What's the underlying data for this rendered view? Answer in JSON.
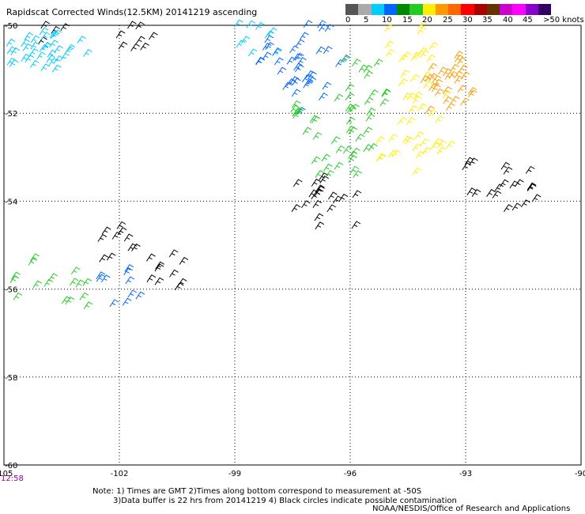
{
  "title": "Rapidscat Corrected Winds(12.5KM) 20141219 ascending",
  "legend": {
    "labels": [
      "0",
      "5",
      "10",
      "15",
      "20",
      "25",
      "30",
      "35",
      "40",
      "45",
      ">50 knots"
    ],
    "colors": [
      "#555555",
      "#aaaaaa",
      "#00ccff",
      "#0066ff",
      "#008800",
      "#22cc22",
      "#ffee00",
      "#ff9900",
      "#ff6600",
      "#ff0000",
      "#aa0000",
      "#663300",
      "#cc00cc",
      "#ff00ff",
      "#8800cc",
      "#330066"
    ]
  },
  "axes": {
    "x_ticks": [
      "-105",
      "-102",
      "-99",
      "-96",
      "-93",
      "-90"
    ],
    "y_ticks": [
      "-50",
      "-52",
      "-54",
      "-56",
      "-58",
      "-60"
    ],
    "xlim": [
      -105,
      -90
    ],
    "ylim": [
      -60,
      -50
    ],
    "grid": true
  },
  "time_label": "12:58",
  "notes": [
    "Note: 1) Times are GMT 2)Times along bottom correspond to measurement at -50S",
    "3)Data buffer is 22 hrs from 20141219 4) Black circles indicate possible contamination"
  ],
  "credit": "NOAA/NESDIS/Office of Research and Applications",
  "chart_data": {
    "type": "scatter",
    "title": "Rapidscat Corrected Winds(12.5KM) 20141219 ascending",
    "xlabel": "",
    "ylabel": "",
    "xlim": [
      -105,
      -90
    ],
    "ylim": [
      -60,
      -50
    ],
    "grid": true,
    "series": [
      {
        "name": "0-5 knots",
        "color": "#000000",
        "points": [
          [
            -97.0,
            -53.9
          ],
          [
            -96.5,
            -54.2
          ],
          [
            -102.0,
            -55.0
          ],
          [
            -101.0,
            -55.6
          ],
          [
            -91.5,
            -53.8
          ],
          [
            -92.5,
            -53.6
          ],
          [
            -103.5,
            -50.2
          ],
          [
            -101.5,
            -50.2
          ]
        ]
      },
      {
        "name": "5-10 knots",
        "color": "#00ccff",
        "points": [
          [
            -104.5,
            -50.4
          ],
          [
            -104.0,
            -50.6
          ],
          [
            -103.5,
            -50.7
          ],
          [
            -104.8,
            -50.9
          ],
          [
            -98.5,
            -50.3
          ]
        ]
      },
      {
        "name": "10-15 knots",
        "color": "#0066ff",
        "points": [
          [
            -98.0,
            -50.7
          ],
          [
            -97.5,
            -51.0
          ],
          [
            -97.2,
            -51.6
          ],
          [
            -96.8,
            -50.5
          ],
          [
            -102.0,
            -56.0
          ]
        ]
      },
      {
        "name": "15-20 knots",
        "color": "#22cc22",
        "points": [
          [
            -97.0,
            -52.2
          ],
          [
            -96.0,
            -52.7
          ],
          [
            -95.5,
            -52.0
          ],
          [
            -96.5,
            -53.2
          ],
          [
            -95.8,
            -51.3
          ],
          [
            -104.5,
            -55.8
          ],
          [
            -103.5,
            -56.1
          ]
        ]
      },
      {
        "name": "20-25 knots",
        "color": "#ffee00",
        "points": [
          [
            -94.5,
            -51.0
          ],
          [
            -94.2,
            -52.0
          ],
          [
            -94.8,
            -53.0
          ],
          [
            -94.0,
            -52.6
          ],
          [
            -94.6,
            -50.4
          ]
        ]
      },
      {
        "name": "25-30 knots",
        "color": "#ff9900",
        "points": [
          [
            -93.5,
            -51.2
          ],
          [
            -93.7,
            -51.6
          ],
          [
            -93.3,
            -51.4
          ]
        ]
      }
    ]
  }
}
